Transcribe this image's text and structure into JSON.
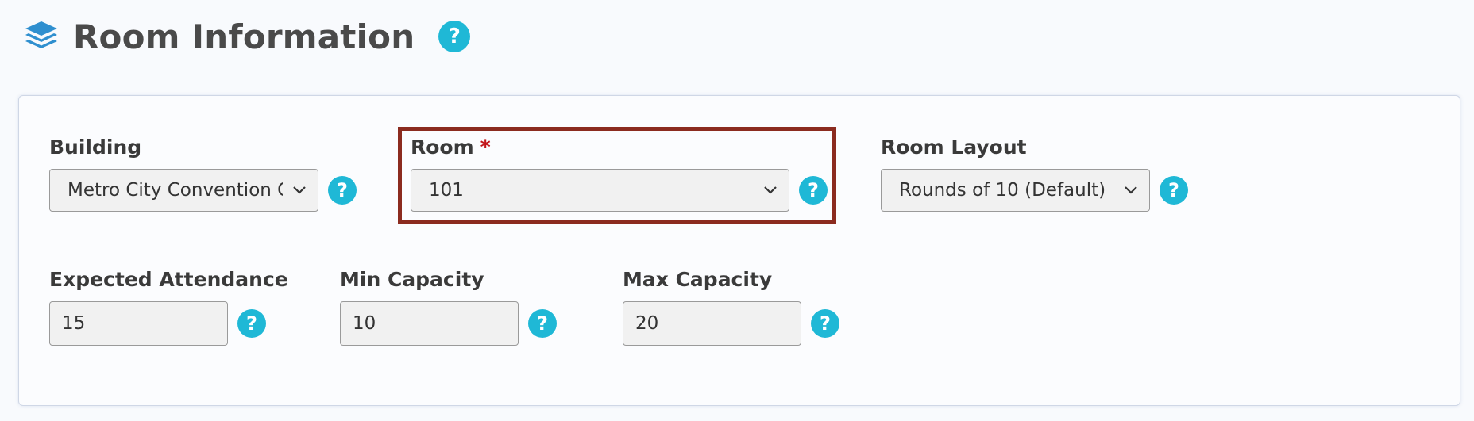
{
  "header": {
    "title": "Room Information",
    "icon": "layers-icon",
    "help_icon": "question-circle-icon"
  },
  "colors": {
    "accent": "#1fb8d6",
    "highlight_border": "#8b2b1f",
    "required": "#c2161b"
  },
  "form": {
    "building": {
      "label": "Building",
      "value": "Metro City Convention Center"
    },
    "room": {
      "label": "Room",
      "required_marker": "*",
      "value": "101"
    },
    "room_layout": {
      "label": "Room Layout",
      "value": "Rounds of 10 (Default)"
    },
    "expected_attendance": {
      "label": "Expected Attendance",
      "value": "15"
    },
    "min_capacity": {
      "label": "Min Capacity",
      "value": "10"
    },
    "max_capacity": {
      "label": "Max Capacity",
      "value": "20"
    }
  }
}
